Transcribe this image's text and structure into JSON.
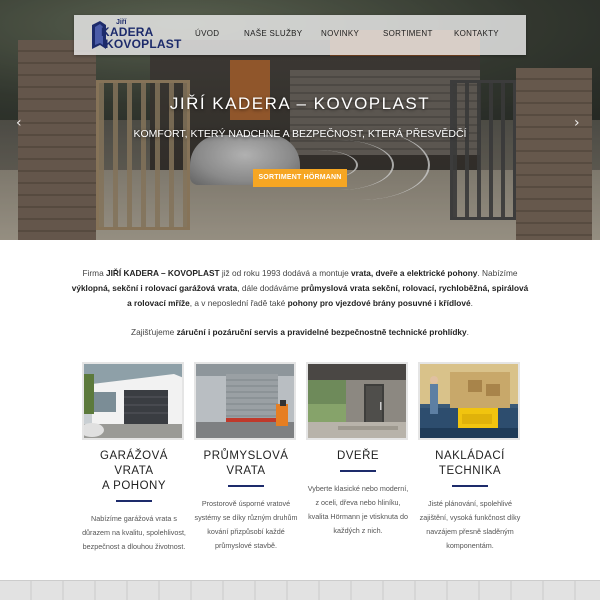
{
  "brand": {
    "logo_top": "Jiří",
    "logo_line1": "KADERA",
    "logo_line2": "KOVOPLAST",
    "color": "#1d2b6b"
  },
  "nav": {
    "items": [
      {
        "label": "ÚVOD"
      },
      {
        "label": "NAŠE SLUŽBY"
      },
      {
        "label": "NOVINKY"
      },
      {
        "label": "SORTIMENT"
      },
      {
        "label": "KONTAKTY"
      }
    ]
  },
  "hero": {
    "title": "JIŘÍ KADERA – KOVOPLAST",
    "subtitle": "KOMFORT, KTERÝ NADCHNE A BEZPEČNOST, KTERÁ PŘESVĚDČÍ",
    "button": "SORTIMENT HÖRMANN",
    "button_color": "#f6a623",
    "prev_icon": "‹",
    "next_icon": "›"
  },
  "intro": {
    "p1_a": "Firma ",
    "p1_b": "JIŘÍ KADERA – KOVOPLAST",
    "p1_c": " již od roku 1993 dodává a montuje ",
    "p1_d": "vrata, dveře a elektrické pohony",
    "p1_e": ". Nabízíme ",
    "p1_f": "výklopná, sekční i rolovací garážová vrata",
    "p1_g": ", dále dodáváme ",
    "p1_h": "průmyslová vrata sekční, rolovací, rychloběžná, spirálová a rolovací mříže",
    "p1_i": ", a v neposlední řadě také ",
    "p1_j": "pohony pro vjezdové brány posuvné i křídlové",
    "p1_k": ".",
    "p2_a": "Zajišťujeme ",
    "p2_b": "záruční i pozáruční servis a pravidelné bezpečnostně technické prohlídky",
    "p2_c": "."
  },
  "cards": [
    {
      "title_line1": "GARÁŽOVÁ VRATA",
      "title_line2": "A POHONY",
      "desc": "Nabízíme garážová vrata s důrazem na kvalitu, spolehlivost, bezpečnost a dlouhou životnost."
    },
    {
      "title_line1": "PRŮMYSLOVÁ",
      "title_line2": "VRATA",
      "desc": "Prostorově úsporné vratové systémy se díky různým druhům kování přizpůsobí každé průmyslové stavbě."
    },
    {
      "title_line1": "DVEŘE",
      "title_line2": "",
      "desc": "Vyberte klasické nebo moderní, z oceli, dřeva nebo hliníku, kvalita Hörmann je vtisknuta do každých z nich."
    },
    {
      "title_line1": "NAKLÁDACÍ",
      "title_line2": "TECHNIKA",
      "desc": "Jisté plánování, spolehlivé zajištění, vysoká funkčnost díky navzájem přesně sladěným komponentám."
    }
  ]
}
